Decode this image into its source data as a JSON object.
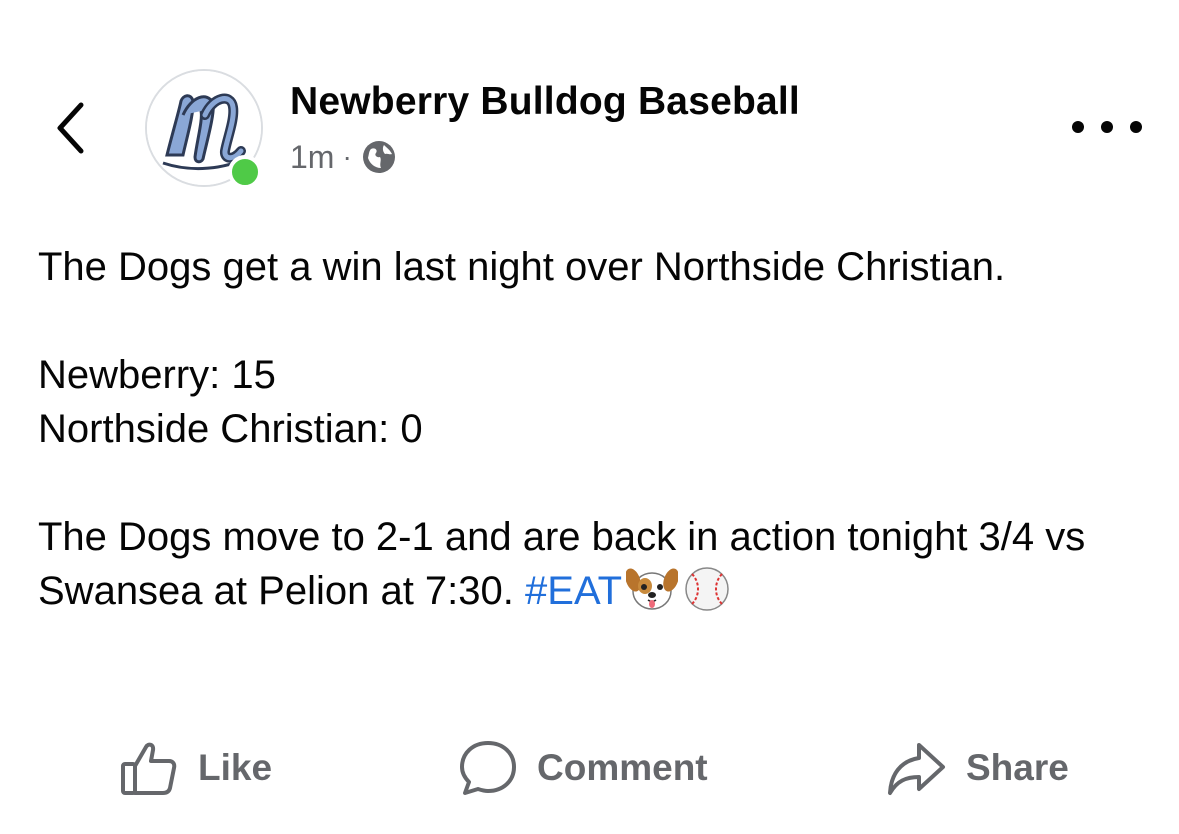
{
  "header": {
    "back_icon": "chevron-left-icon",
    "page_name": "Newberry Bulldog Baseball",
    "timestamp": "1m",
    "separator": "·",
    "privacy_icon": "globe-icon",
    "more_icon": "more-dots-icon",
    "avatar_status": "online",
    "online_color": "#4fca47"
  },
  "post": {
    "line1": "The Dogs get a win last night over Northside Christian.",
    "score_home": "Newberry: 15",
    "score_away": "Northside Christian: 0",
    "line3": "The Dogs move to 2-1 and are back in action tonight 3/4 vs Swansea at Pelion at 7:30.",
    "hashtag": "#EAT",
    "hashtag_color": "#216fdb",
    "emojis": [
      "dog-face-icon",
      "baseball-icon"
    ]
  },
  "actions": {
    "like_label": "Like",
    "comment_label": "Comment",
    "share_label": "Share"
  }
}
